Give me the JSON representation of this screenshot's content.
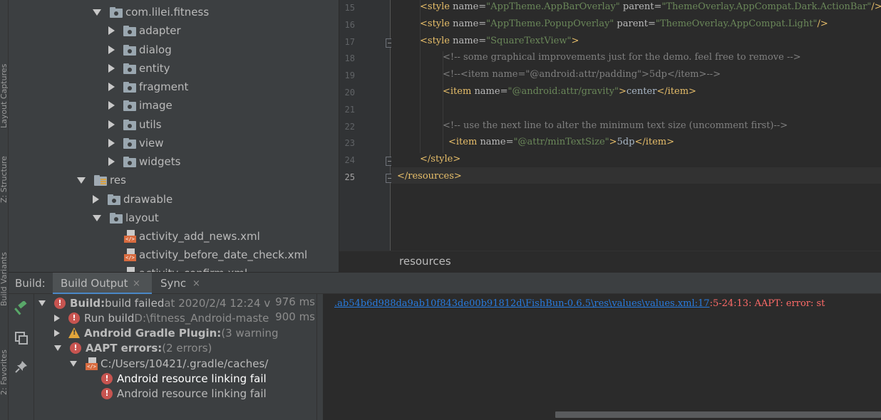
{
  "side_stripe": {
    "labels": [
      "Layout Captures",
      "Z: Structure",
      "Build Variants",
      "2: Favorites"
    ]
  },
  "project_tree": {
    "items": [
      {
        "label": "com.lilei.fitness",
        "kind": "package",
        "state": "expanded"
      },
      {
        "label": "adapter",
        "kind": "package",
        "state": "collapsed"
      },
      {
        "label": "dialog",
        "kind": "package",
        "state": "collapsed"
      },
      {
        "label": "entity",
        "kind": "package",
        "state": "collapsed"
      },
      {
        "label": "fragment",
        "kind": "package",
        "state": "collapsed"
      },
      {
        "label": "image",
        "kind": "package",
        "state": "collapsed"
      },
      {
        "label": "utils",
        "kind": "package",
        "state": "collapsed"
      },
      {
        "label": "view",
        "kind": "package",
        "state": "collapsed"
      },
      {
        "label": "widgets",
        "kind": "package",
        "state": "collapsed"
      },
      {
        "label": "res",
        "kind": "res-folder",
        "state": "expanded"
      },
      {
        "label": "drawable",
        "kind": "package",
        "state": "collapsed"
      },
      {
        "label": "layout",
        "kind": "package",
        "state": "expanded"
      },
      {
        "label": "activity_add_news.xml",
        "kind": "xml-file"
      },
      {
        "label": "activity_before_date_check.xml",
        "kind": "xml-file"
      },
      {
        "label": "activity_confirm.xml",
        "kind": "xml-file"
      }
    ]
  },
  "editor": {
    "line_numbers": [
      "15",
      "16",
      "17",
      "18",
      "19",
      "20",
      "21",
      "22",
      "23",
      "24",
      "25"
    ],
    "current_line": "25",
    "lines": [
      {
        "seg": [
          [
            "t",
            "<style "
          ],
          [
            "a",
            "name="
          ],
          [
            "s",
            "\"AppTheme.AppBarOverlay\""
          ],
          [
            "a",
            " parent="
          ],
          [
            "s",
            "\"ThemeOverlay.AppCompat.Dark.ActionBar\""
          ],
          [
            "t",
            "/>"
          ]
        ]
      },
      {
        "seg": [
          [
            "t",
            "<style "
          ],
          [
            "a",
            "name="
          ],
          [
            "s",
            "\"AppTheme.PopupOverlay\""
          ],
          [
            "a",
            " parent="
          ],
          [
            "s",
            "\"ThemeOverlay.AppCompat.Light\""
          ],
          [
            "t",
            "/>"
          ]
        ]
      },
      {
        "seg": [
          [
            "t",
            "<style "
          ],
          [
            "a",
            "name="
          ],
          [
            "s",
            "\"SquareTextView\""
          ],
          [
            "t",
            ">"
          ]
        ]
      },
      {
        "seg": [
          [
            "c",
            "<!-- some graphical improvements just for the demo. feel free to remove -->"
          ]
        ]
      },
      {
        "seg": [
          [
            "c",
            "<!--<item name=\"@android:attr/padding\">5dp</item>-->"
          ]
        ]
      },
      {
        "seg": [
          [
            "t",
            "<item "
          ],
          [
            "a",
            "name="
          ],
          [
            "s",
            "\"@android:attr/gravity\""
          ],
          [
            "t",
            ">"
          ],
          [
            "tx",
            "center"
          ],
          [
            "t",
            "</item>"
          ]
        ]
      },
      {
        "seg": []
      },
      {
        "seg": [
          [
            "c",
            "<!-- use the next line to alter the minimum text size (uncomment first)-->"
          ]
        ]
      },
      {
        "seg": [
          [
            "t",
            "<item "
          ],
          [
            "a",
            "name="
          ],
          [
            "s",
            "\"@attr/minTextSize\""
          ],
          [
            "t",
            ">"
          ],
          [
            "tx",
            "5dp"
          ],
          [
            "t",
            "</item>"
          ]
        ]
      },
      {
        "seg": [
          [
            "t",
            "</style>"
          ]
        ]
      },
      {
        "seg": [
          [
            "t",
            "</resources>"
          ]
        ]
      }
    ],
    "breadcrumb": "resources"
  },
  "build_panel": {
    "label": "Build:",
    "tabs": [
      {
        "label": "Build Output",
        "selected": true
      },
      {
        "label": "Sync",
        "selected": false
      }
    ],
    "close_glyph": "×",
    "tree": [
      {
        "bold": "Build:",
        "rest": " build failed",
        "dim": " at 2020/2/4 12:24 v",
        "time": "976 ms",
        "icon": "error",
        "arrow": "down"
      },
      {
        "bold": "",
        "rest": "Run build ",
        "dim": "D:\\fitness_Android-maste",
        "time": "900 ms",
        "icon": "error",
        "arrow": "right"
      },
      {
        "bold": "Android Gradle Plugin:",
        "rest": "",
        "dim": " (3 warning",
        "time": "",
        "icon": "warning",
        "arrow": "right"
      },
      {
        "bold": "AAPT errors:",
        "rest": "",
        "dim": " (2 errors)",
        "time": "",
        "icon": "error",
        "arrow": "down"
      },
      {
        "bold": "",
        "rest": "C:/Users/10421/.gradle/caches/",
        "dim": "",
        "time": "",
        "icon": "xml",
        "arrow": "down"
      },
      {
        "bold": "",
        "rest": "Android resource linking fail",
        "dim": "",
        "time": "",
        "icon": "error",
        "arrow": "",
        "selected": true
      },
      {
        "bold": "",
        "rest": "Android resource linking fail",
        "dim": "",
        "time": "",
        "icon": "error",
        "arrow": ""
      }
    ],
    "console": {
      "link": ".ab54b6d988da9ab10f843de00b91812d\\FishBun-0.6.5\\res\\values\\values.xml:17",
      "error": ":5-24:13: AAPT: error: st"
    }
  },
  "colors": {
    "accent": "#4a88c7",
    "selection": "#2f65ca",
    "error": "#c75450",
    "warning": "#e2a53a",
    "link": "#287bde"
  }
}
